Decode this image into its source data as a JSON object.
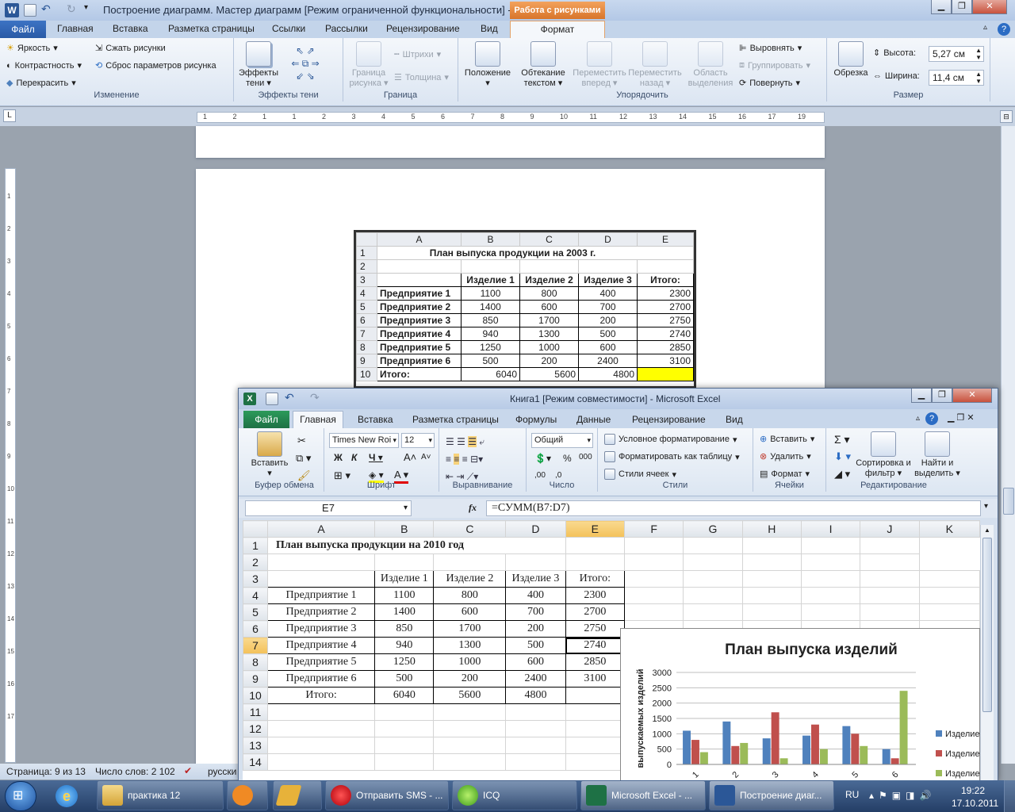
{
  "word": {
    "title": "Построение диаграмм. Мастер диаграмм [Режим ограниченной функциональности]  -  M...",
    "context_tab": "Работа с рисунками",
    "tabs": [
      "Файл",
      "Главная",
      "Вставка",
      "Разметка страницы",
      "Ссылки",
      "Рассылки",
      "Рецензирование",
      "Вид",
      "Формат"
    ],
    "groups": {
      "change": {
        "name": "Изменение",
        "brightness": "Яркость",
        "contrast": "Контрастность",
        "recolor": "Перекрасить",
        "compress": "Сжать рисунки",
        "reset": "Сброс параметров рисунка"
      },
      "shadow": {
        "name": "Эффекты тени",
        "effects": "Эффекты тени"
      },
      "border": {
        "name": "Граница",
        "border": "Граница рисунка",
        "dashes": "Штрихи",
        "weight": "Толщина"
      },
      "arrange": {
        "name": "Упорядочить",
        "position": "Положение",
        "wrap": "Обтекание текстом",
        "forward": "Переместить вперед",
        "backward": "Переместить назад",
        "pane": "Область выделения",
        "align": "Выровнять",
        "group": "Группировать",
        "rotate": "Повернуть"
      },
      "size": {
        "name": "Размер",
        "crop": "Обрезка",
        "height_label": "Высота:",
        "height": "5,27 см",
        "width_label": "Ширина:",
        "width": "11,4 см"
      }
    },
    "ruler": [
      "1",
      "2",
      "1",
      "1",
      "2",
      "3",
      "4",
      "5",
      "6",
      "7",
      "8",
      "9",
      "10",
      "11",
      "12",
      "13",
      "14",
      "15",
      "16",
      "17",
      "19"
    ],
    "vruler": [
      "1",
      "2",
      "3",
      "4",
      "5",
      "6",
      "7",
      "8",
      "9",
      "10",
      "11",
      "12",
      "13",
      "14",
      "15",
      "16",
      "17"
    ],
    "table": {
      "cols": [
        "A",
        "B",
        "C",
        "D",
        "E"
      ],
      "title": "План выпуска продукции на 2003 г.",
      "headers": [
        "Изделие 1",
        "Изделие 2",
        "Изделие 3",
        "Итого:"
      ],
      "rows": [
        {
          "n": "4",
          "name": "Предприятие 1",
          "v": [
            "1100",
            "800",
            "400",
            "2300"
          ]
        },
        {
          "n": "5",
          "name": "Предприятие 2",
          "v": [
            "1400",
            "600",
            "700",
            "2700"
          ]
        },
        {
          "n": "6",
          "name": "Предприятие 3",
          "v": [
            "850",
            "1700",
            "200",
            "2750"
          ]
        },
        {
          "n": "7",
          "name": "Предприятие 4",
          "v": [
            "940",
            "1300",
            "500",
            "2740"
          ]
        },
        {
          "n": "8",
          "name": "Предприятие 5",
          "v": [
            "1250",
            "1000",
            "600",
            "2850"
          ]
        },
        {
          "n": "9",
          "name": "Предприятие 6",
          "v": [
            "500",
            "200",
            "2400",
            "3100"
          ]
        }
      ],
      "total": {
        "n": "10",
        "name": "Итого:",
        "v": [
          "6040",
          "5600",
          "4800",
          ""
        ]
      }
    },
    "status": {
      "page": "Страница: 9 из 13",
      "words": "Число слов: 2 102",
      "lang": "русски"
    }
  },
  "excel": {
    "title": "Книга1  [Режим совместимости]  -  Microsoft Excel",
    "tabs": [
      "Файл",
      "Главная",
      "Вставка",
      "Разметка страницы",
      "Формулы",
      "Данные",
      "Рецензирование",
      "Вид"
    ],
    "ribbon": {
      "clipboard": "Буфер обмена",
      "paste": "Вставить",
      "font": "Шрифт",
      "font_name": "Times New Roi",
      "font_size": "12",
      "align": "Выравнивание",
      "number": "Число",
      "number_format": "Общий",
      "styles": "Стили",
      "cond": "Условное форматирование",
      "as_table": "Форматировать как таблицу",
      "cell_styles": "Стили ячеек",
      "cells": "Ячейки",
      "insert": "Вставить",
      "delete": "Удалить",
      "format": "Формат",
      "edit": "Редактирование",
      "sort": "Сортировка и фильтр",
      "find": "Найти и выделить"
    },
    "namebox": "E7",
    "formula": "=СУММ(B7:D7)",
    "cols": [
      "A",
      "B",
      "C",
      "D",
      "E",
      "F",
      "G",
      "H",
      "I",
      "J",
      "K"
    ],
    "title_cell": "План выпуска продукции на 2010 год",
    "headers": [
      "Изделие 1",
      "Изделие 2",
      "Изделие 3",
      "Итого:"
    ],
    "rows": [
      {
        "n": "4",
        "name": "Предприятие 1",
        "v": [
          "1100",
          "800",
          "400",
          "2300"
        ]
      },
      {
        "n": "5",
        "name": "Предприятие 2",
        "v": [
          "1400",
          "600",
          "700",
          "2700"
        ]
      },
      {
        "n": "6",
        "name": "Предприятие 3",
        "v": [
          "850",
          "1700",
          "200",
          "2750"
        ]
      },
      {
        "n": "7",
        "name": "Предприятие 4",
        "v": [
          "940",
          "1300",
          "500",
          "2740"
        ]
      },
      {
        "n": "8",
        "name": "Предприятие 5",
        "v": [
          "1250",
          "1000",
          "600",
          "2850"
        ]
      },
      {
        "n": "9",
        "name": "Предприятие 6",
        "v": [
          "500",
          "200",
          "2400",
          "3100"
        ]
      }
    ],
    "total": {
      "n": "10",
      "name": "Итого:",
      "v": [
        "6040",
        "5600",
        "4800",
        ""
      ]
    },
    "empty_rows": [
      "11",
      "12",
      "13",
      "14"
    ]
  },
  "chart_data": {
    "type": "bar",
    "title": "План выпуска изделий",
    "ylabel": "выпускаемых изделий",
    "categories": [
      "1",
      "2",
      "3",
      "4",
      "5",
      "6"
    ],
    "ylim": [
      0,
      3000
    ],
    "yticks": [
      "0",
      "500",
      "1000",
      "1500",
      "2000",
      "2500",
      "3000"
    ],
    "legend_placement": "right",
    "series": [
      {
        "name": "Изделие",
        "values": [
          1100,
          1400,
          850,
          940,
          1250,
          500
        ],
        "color": "#4f81bd"
      },
      {
        "name": "Изделие",
        "values": [
          800,
          600,
          1700,
          1300,
          1000,
          200
        ],
        "color": "#c0504d"
      },
      {
        "name": "Изделие",
        "values": [
          400,
          700,
          200,
          500,
          600,
          2400
        ],
        "color": "#9bbb59"
      }
    ]
  },
  "taskbar": {
    "items": [
      "практика 12",
      "",
      "",
      "Отправить SMS - ...",
      "ICQ",
      "Microsoft Excel - ...",
      "Построение диаг..."
    ],
    "lang": "RU",
    "time": "19:22",
    "date": "17.10.2011"
  }
}
